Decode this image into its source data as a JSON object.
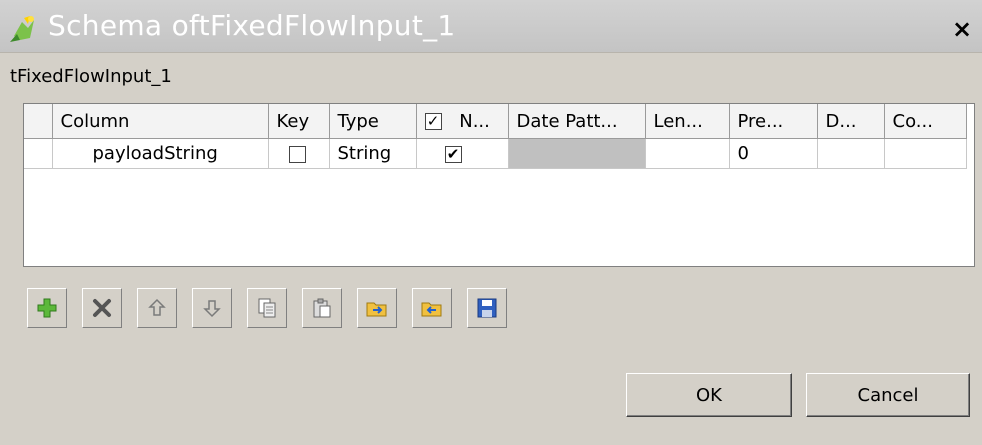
{
  "window": {
    "title": "Schema oftFixedFlowInput_1",
    "close_label": "×"
  },
  "subtitle": "tFixedFlowInput_1",
  "table": {
    "headers": [
      "Column",
      "Key",
      "Type",
      "N...",
      "Date Patt...",
      "Len...",
      "Pre...",
      "D...",
      "Co..."
    ],
    "nullable_header_checked": true,
    "rows": [
      {
        "column": "payloadString",
        "key": false,
        "type": "String",
        "nullable": true,
        "date_pattern": "",
        "length": "",
        "precision": "0",
        "default": "",
        "comment": ""
      }
    ]
  },
  "toolbar": {
    "buttons": [
      "add-icon",
      "remove-icon",
      "move-up-icon",
      "move-down-icon",
      "copy-icon",
      "paste-icon",
      "import-icon",
      "export-icon",
      "save-icon"
    ]
  },
  "buttons": {
    "ok": "OK",
    "cancel": "Cancel"
  },
  "colors": {
    "dialog_bg": "#d4d0c8",
    "titlebar_bg": "#c8c8c8",
    "date_cell_bg": "#c0c0c0"
  }
}
